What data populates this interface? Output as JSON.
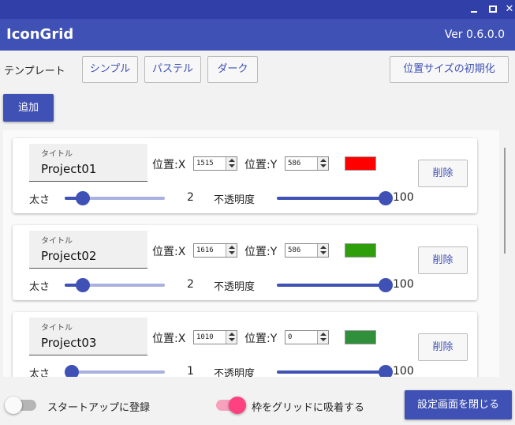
{
  "window": {
    "min_glyph": "—",
    "max_glyph": "□",
    "close_glyph": "✕"
  },
  "app": {
    "title": "IconGrid",
    "version": "Ver 0.6.0.0"
  },
  "toolbar": {
    "template_label": "テンプレート",
    "templates": [
      "シンプル",
      "パステル",
      "ダーク"
    ],
    "reset_label": "位置サイズの初期化",
    "add_label": "追加"
  },
  "labels": {
    "title_caption": "タイトル",
    "pos_x": "位置:X",
    "pos_y": "位置:Y",
    "thickness": "太さ",
    "opacity": "不透明度",
    "delete": "削除"
  },
  "projects": [
    {
      "title": "Project01",
      "x": "1515",
      "y": "586",
      "color": "#ff0000",
      "thickness": 2,
      "opacity": 100,
      "thickness_max": 10
    },
    {
      "title": "Project02",
      "x": "1616",
      "y": "586",
      "color": "#2e9e0a",
      "thickness": 2,
      "opacity": 100,
      "thickness_max": 10
    },
    {
      "title": "Project03",
      "x": "1010",
      "y": "0",
      "color": "#2f8f3a",
      "thickness": 1,
      "opacity": 100,
      "thickness_max": 10
    }
  ],
  "bottom": {
    "startup_label": "スタートアップに登録",
    "startup_on": false,
    "snap_label": "枠をグリッドに吸着する",
    "snap_on": true,
    "close_label": "設定画面を閉じる"
  },
  "colors": {
    "accent": "#3f51b5",
    "accent_light": "#a8b1df",
    "toggle_on": "#ff4081",
    "toggle_on_track": "#f7a1bd"
  }
}
